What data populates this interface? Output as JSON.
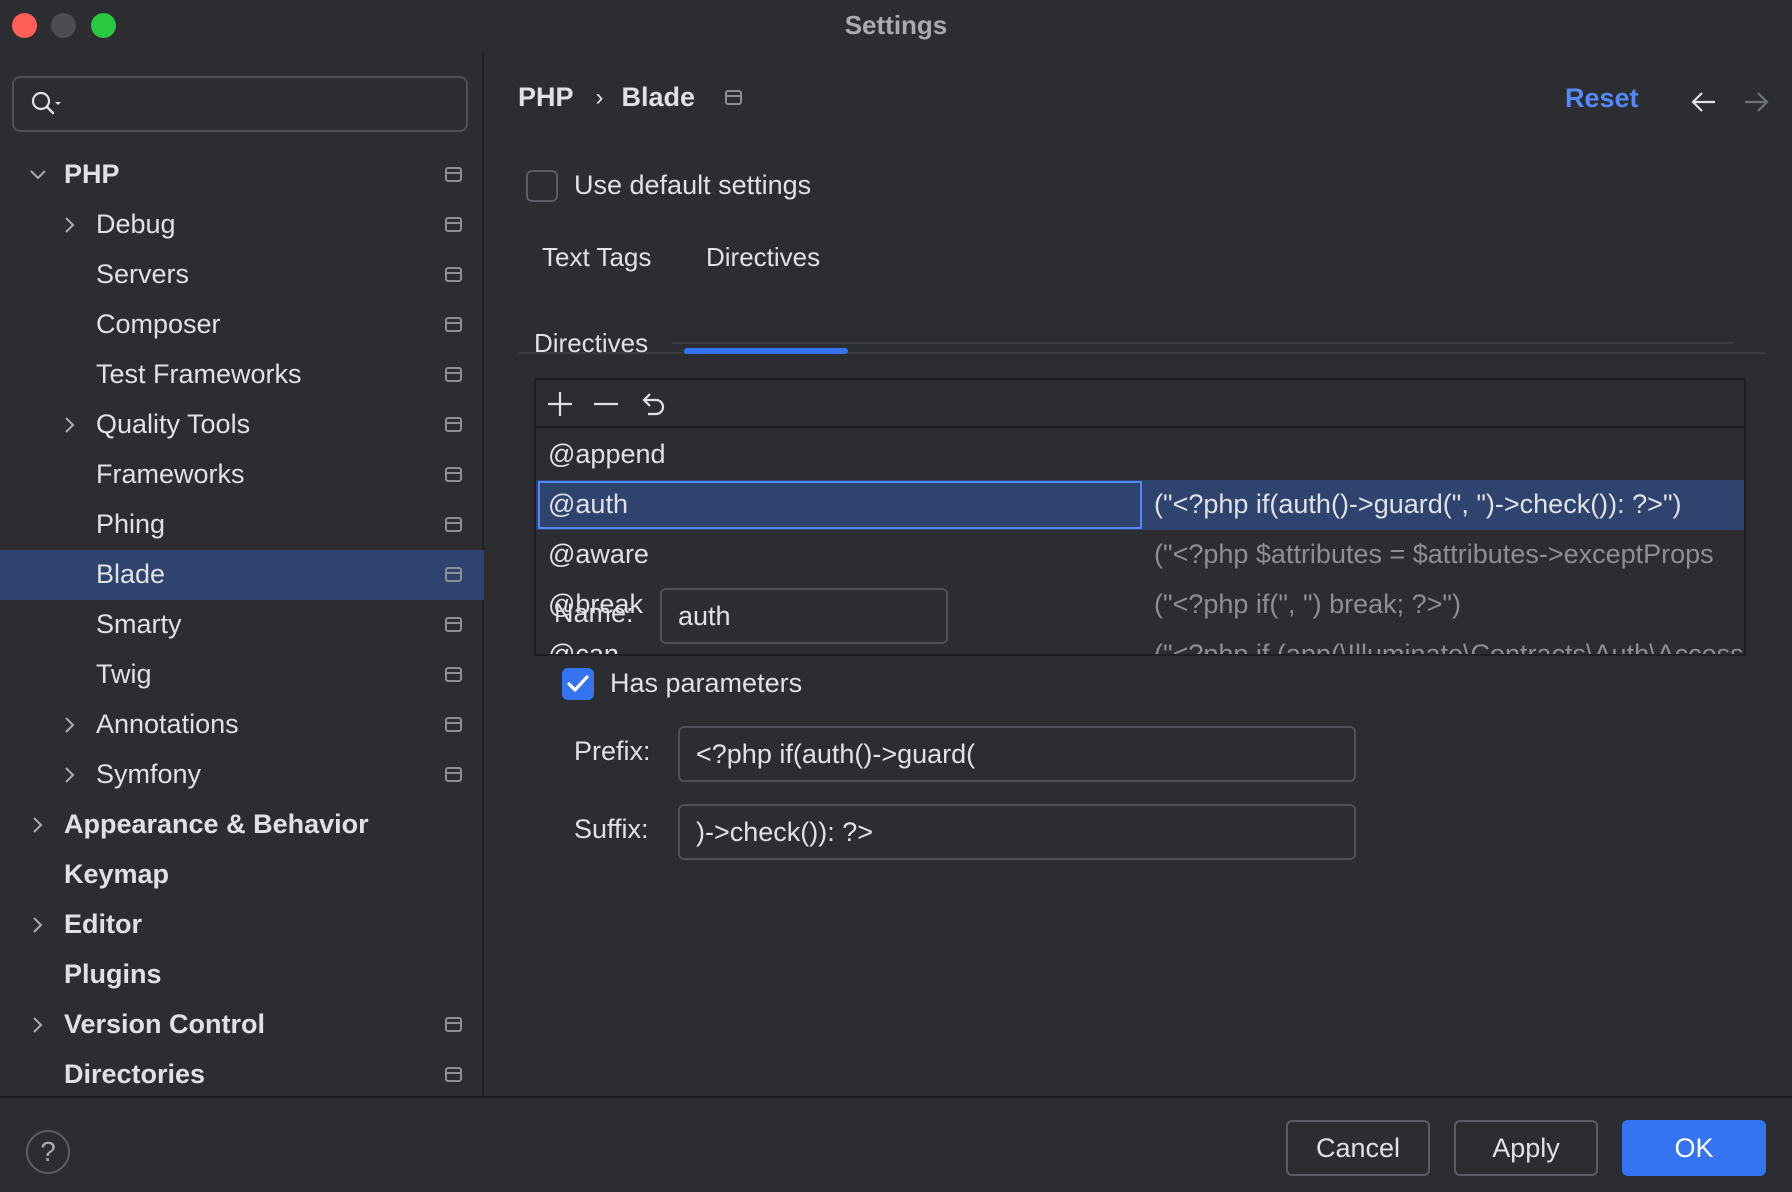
{
  "window": {
    "title": "Settings"
  },
  "search": {
    "placeholder": ""
  },
  "sidebar": {
    "items": [
      {
        "label": "PHP",
        "bold": false,
        "expandable": true,
        "expanded": true,
        "indent": 0,
        "project": true
      },
      {
        "label": "Debug",
        "expandable": true,
        "indent": 1,
        "project": true
      },
      {
        "label": "Servers",
        "indent": 1,
        "project": true
      },
      {
        "label": "Composer",
        "indent": 1,
        "project": true
      },
      {
        "label": "Test Frameworks",
        "indent": 1,
        "project": true
      },
      {
        "label": "Quality Tools",
        "expandable": true,
        "indent": 1,
        "project": true
      },
      {
        "label": "Frameworks",
        "indent": 1,
        "project": true
      },
      {
        "label": "Phing",
        "indent": 1,
        "project": true
      },
      {
        "label": "Blade",
        "indent": 1,
        "project": true,
        "selected": true
      },
      {
        "label": "Smarty",
        "indent": 1,
        "project": true
      },
      {
        "label": "Twig",
        "indent": 1,
        "project": true
      },
      {
        "label": "Annotations",
        "expandable": true,
        "indent": 1,
        "project": true
      },
      {
        "label": "Symfony",
        "expandable": true,
        "indent": 1,
        "project": true
      },
      {
        "label": "Appearance & Behavior",
        "bold": true,
        "expandable": true,
        "indent": 0
      },
      {
        "label": "Keymap",
        "bold": true,
        "indent": 0
      },
      {
        "label": "Editor",
        "bold": true,
        "expandable": true,
        "indent": 0
      },
      {
        "label": "Plugins",
        "bold": true,
        "indent": 0
      },
      {
        "label": "Version Control",
        "bold": true,
        "expandable": true,
        "indent": 0,
        "project": true
      },
      {
        "label": "Directories",
        "bold": true,
        "indent": 0,
        "project": true
      }
    ]
  },
  "header": {
    "breadcrumb": [
      "PHP",
      "Blade"
    ],
    "separator": "›",
    "reset_label": "Reset"
  },
  "use_default": {
    "label": "Use default settings",
    "checked": false
  },
  "tabs": [
    {
      "label": "Text Tags",
      "active": false
    },
    {
      "label": "Directives",
      "active": true
    }
  ],
  "directives": {
    "group_title": "Directives",
    "rows": [
      {
        "name": "@append",
        "value": ""
      },
      {
        "name": "@auth",
        "value": "(\"<?php if(auth()->guard(\", \")->check()): ?>\")",
        "selected": true
      },
      {
        "name": "@aware",
        "value": "(\"<?php $attributes = $attributes->exceptProps"
      },
      {
        "name": "@break",
        "value": "(\"<?php if(\", \") break; ?>\")"
      },
      {
        "name": "@can",
        "value": "(\"<?php if (app(\\Illuminate\\Contracts\\Auth\\Access"
      }
    ]
  },
  "form": {
    "name_label": "Name:",
    "name_value": "auth",
    "has_params_label": "Has parameters",
    "has_params_checked": true,
    "prefix_label": "Prefix:",
    "prefix_value": "<?php if(auth()->guard(",
    "suffix_label": "Suffix:",
    "suffix_value": ")->check()): ?>"
  },
  "footer": {
    "help": "?",
    "cancel": "Cancel",
    "apply": "Apply",
    "ok": "OK"
  },
  "colors": {
    "accent": "#3574f0",
    "link": "#548af7",
    "selection": "#2e436e",
    "background": "#2b2d30"
  }
}
